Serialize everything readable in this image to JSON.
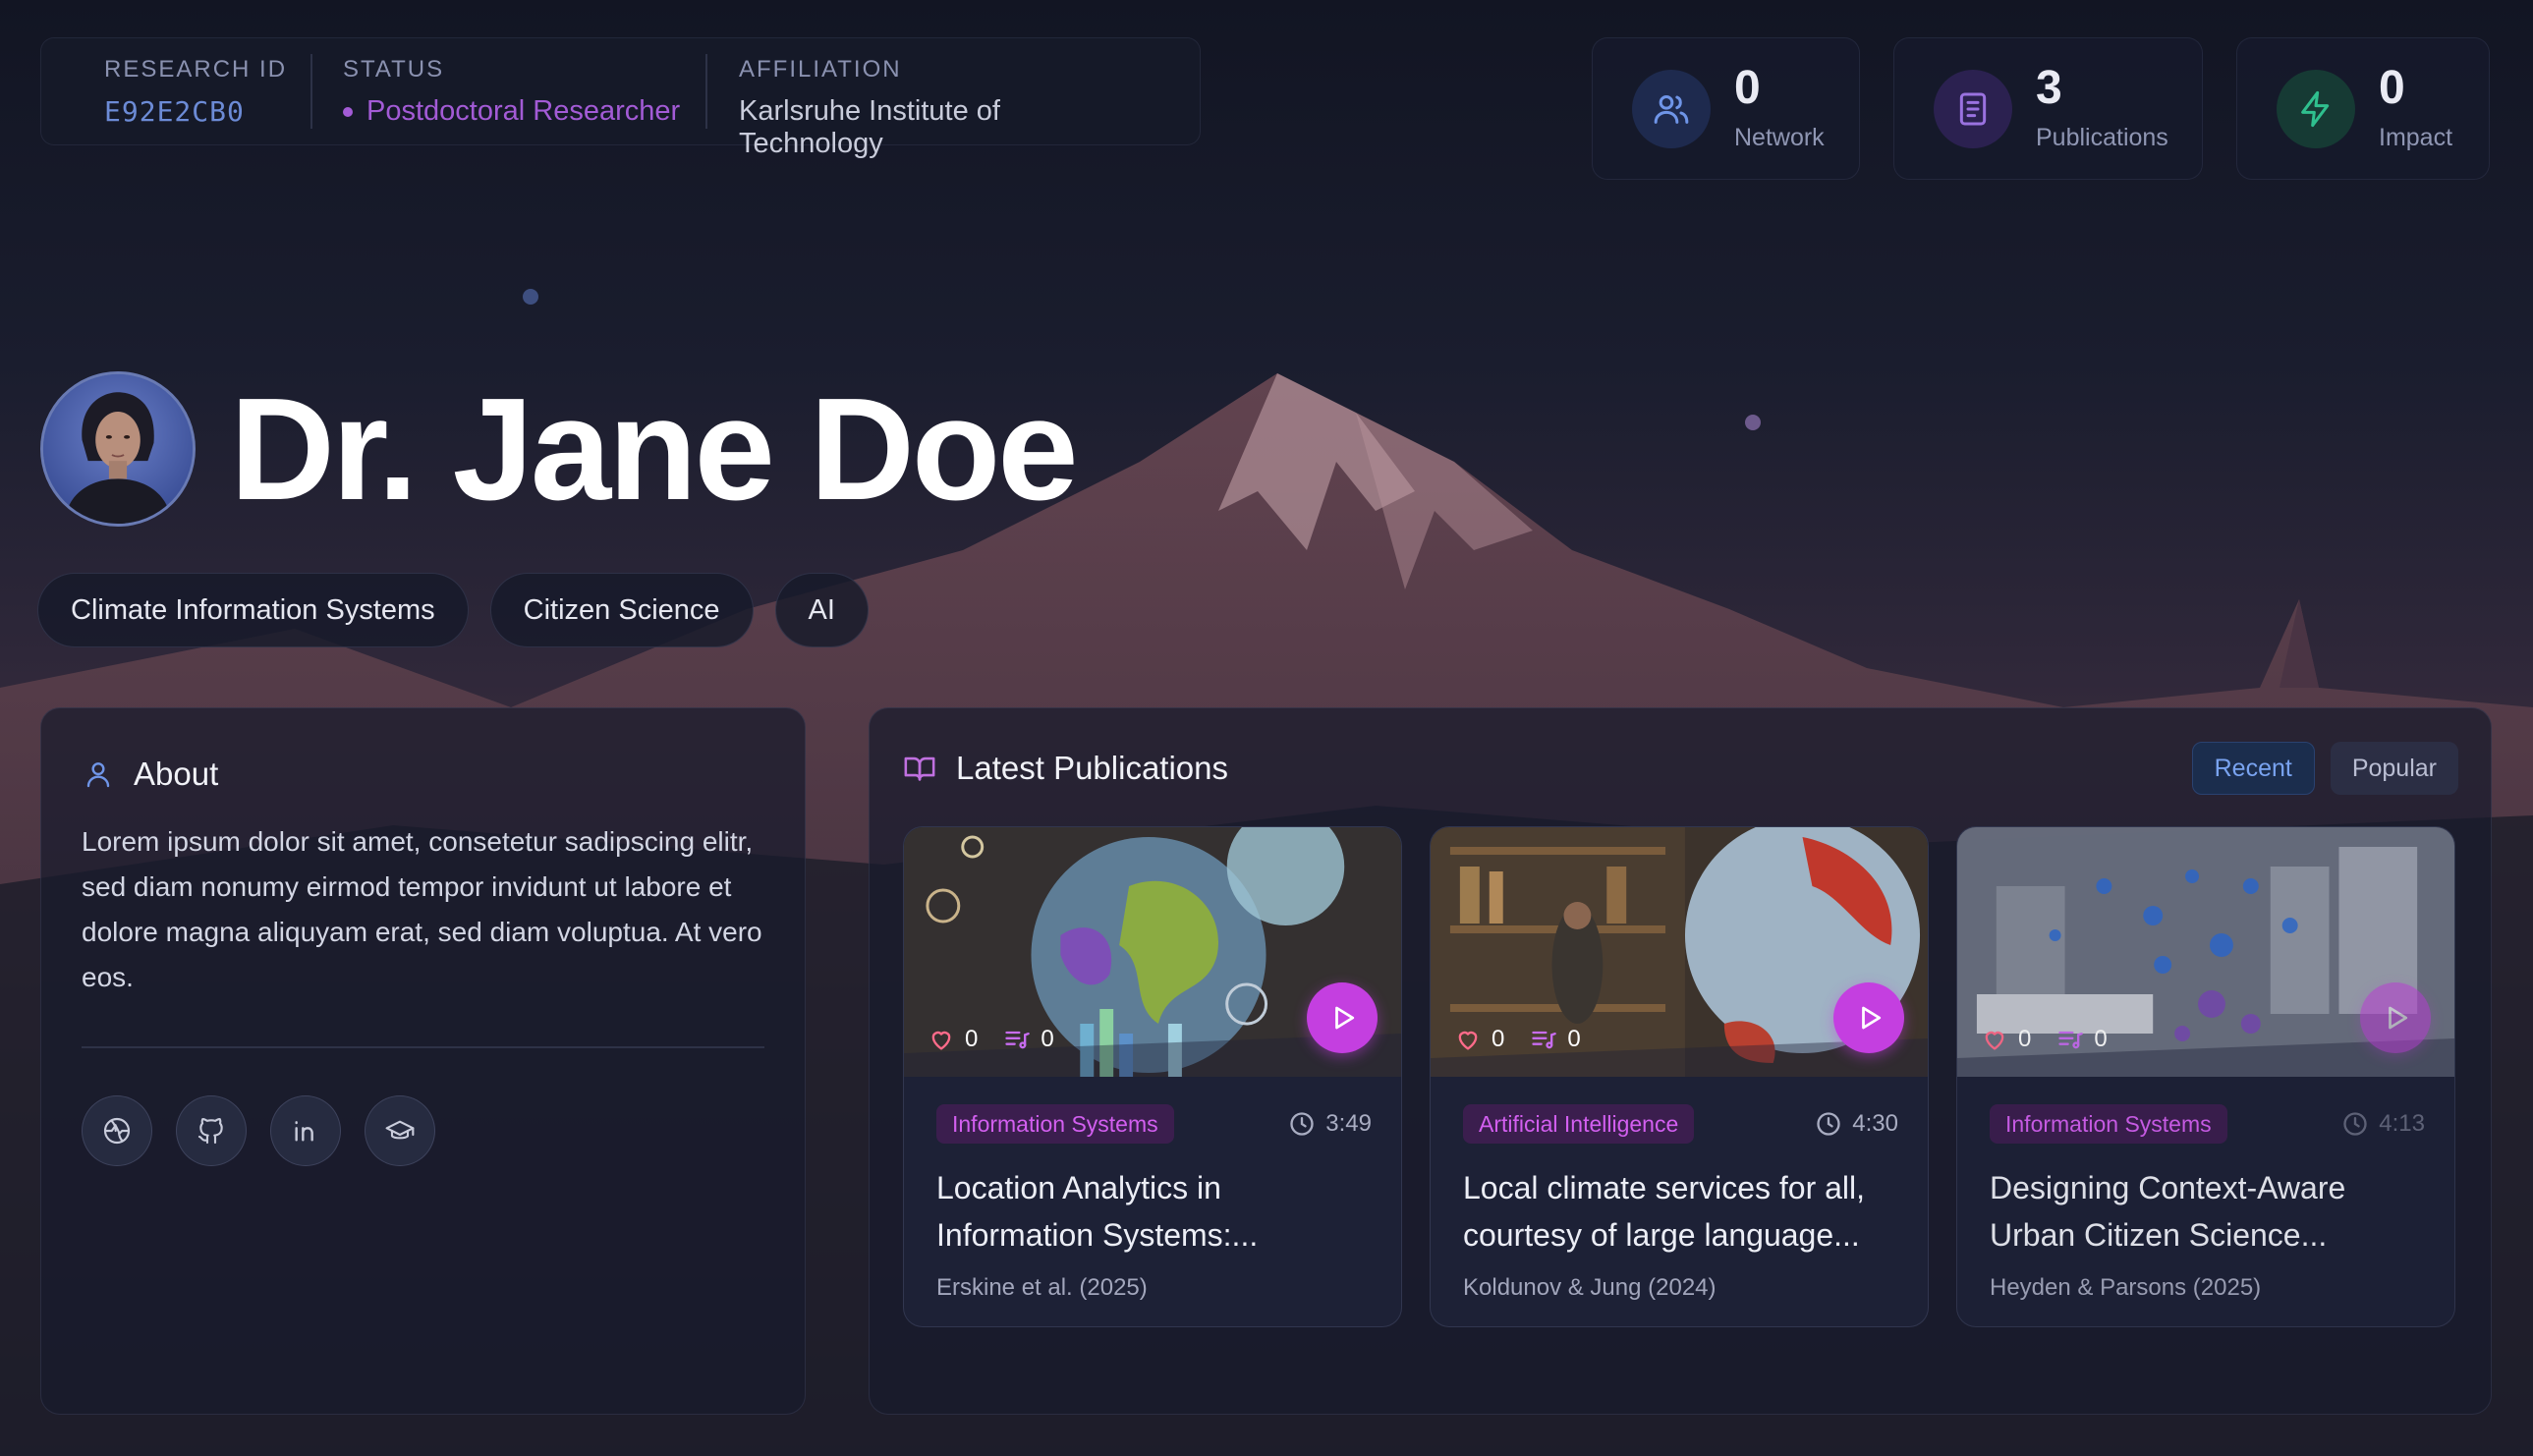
{
  "profile": {
    "research_id_label": "RESEARCH ID",
    "research_id": "E92E2CB0",
    "status_label": "STATUS",
    "status": "Postdoctoral Researcher",
    "affiliation_label": "AFFILIATION",
    "affiliation": "Karlsruhe Institute of Technology",
    "name": "Dr. Jane Doe",
    "tags": [
      "Climate Information Systems",
      "Citizen Science",
      "AI"
    ]
  },
  "stats": [
    {
      "value": "0",
      "label": "Network",
      "icon": "users-icon"
    },
    {
      "value": "3",
      "label": "Publications",
      "icon": "book-icon"
    },
    {
      "value": "0",
      "label": "Impact",
      "icon": "lightning-icon"
    }
  ],
  "about": {
    "title": "About",
    "text": "Lorem ipsum dolor sit amet, consetetur sadipscing elitr, sed diam nonumy eirmod tempor invidunt ut labore et dolore magna aliquyam erat, sed diam voluptua. At vero eos.",
    "socials": [
      "website-icon",
      "github-icon",
      "linkedin-icon",
      "scholar-icon"
    ]
  },
  "publications": {
    "title": "Latest Publications",
    "sort_recent": "Recent",
    "sort_popular": "Popular",
    "items": [
      {
        "category": "Information Systems",
        "duration": "3:49",
        "title": "Location Analytics in Information Systems:...",
        "authors": "Erskine et al. (2025)",
        "likes": "0",
        "saves": "0"
      },
      {
        "category": "Artificial Intelligence",
        "duration": "4:30",
        "title": "Local climate services for all, courtesy of large language...",
        "authors": "Koldunov & Jung (2024)",
        "likes": "0",
        "saves": "0"
      },
      {
        "category": "Information Systems",
        "duration": "4:13",
        "title": "Designing Context-Aware Urban Citizen Science...",
        "authors": "Heyden & Parsons (2025)",
        "likes": "0",
        "saves": "0"
      }
    ]
  },
  "colors": {
    "accent_magenta": "#c43fe0",
    "accent_blue": "#6f95e8",
    "status_purple": "#a35bd6",
    "impact_green": "#2fbf8e"
  }
}
